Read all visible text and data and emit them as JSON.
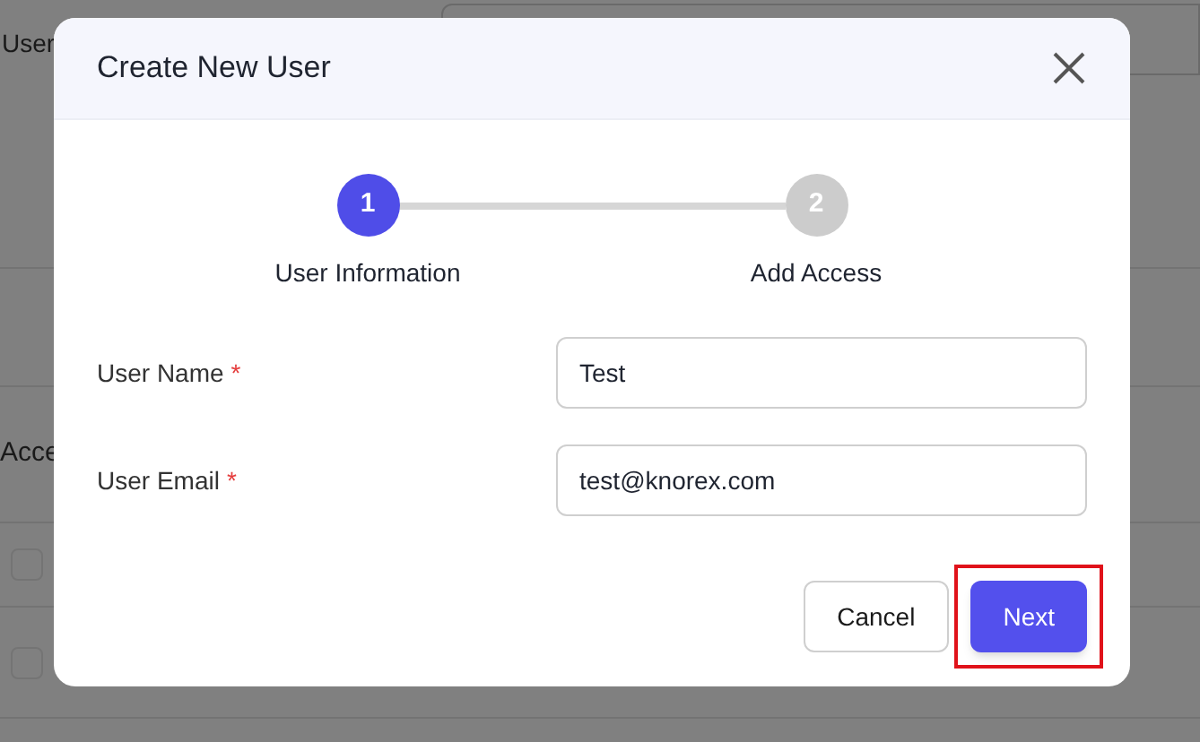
{
  "background": {
    "field_label": "User",
    "section_title": "Acce",
    "rows": [
      {
        "checked": false
      },
      {
        "checked": false
      }
    ]
  },
  "dialog": {
    "title": "Create New User",
    "steps": [
      {
        "number": "1",
        "label": "User Information",
        "selected": true
      },
      {
        "number": "2",
        "label": "Add Access",
        "selected": false
      }
    ],
    "fields": [
      {
        "label": "User Name",
        "required_marker": "*",
        "value": "Test"
      },
      {
        "label": "User Email",
        "required_marker": "*",
        "value": "test@knorex.com"
      }
    ],
    "buttons": [
      {
        "label": "Cancel",
        "kind": "secondary",
        "highlighted": false
      },
      {
        "label": "Next",
        "kind": "primary",
        "highlighted": true
      }
    ]
  }
}
